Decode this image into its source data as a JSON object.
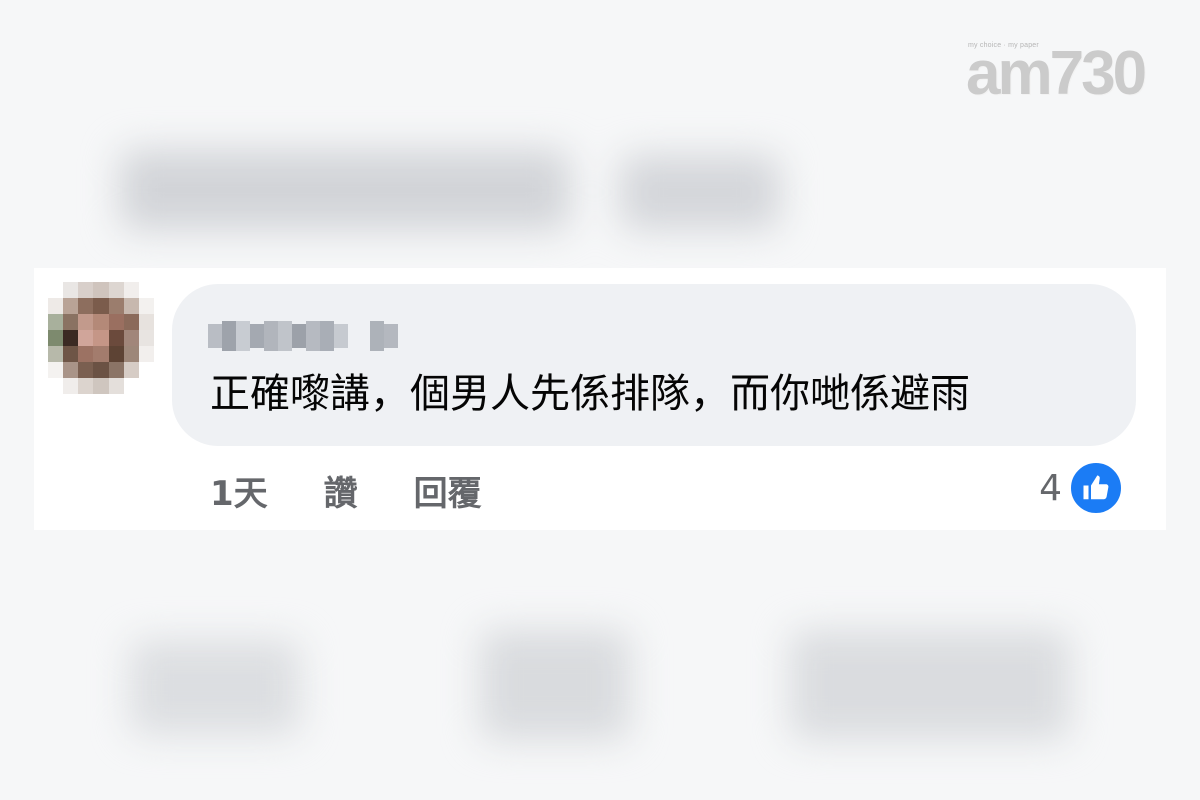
{
  "watermark": {
    "logo": "am730",
    "tagline": "my choice · my paper"
  },
  "comment": {
    "author_name": "",
    "text": "正確嚟講，個男人先係排隊，而你哋係避雨",
    "time": "1天",
    "like_label": "讚",
    "reply_label": "回覆",
    "reaction_count": "4",
    "reaction_icon": "thumbs-up-icon"
  },
  "colors": {
    "bubble": "#eff1f4",
    "action_text": "#65676b",
    "like_blue": "#1b7cf5"
  }
}
